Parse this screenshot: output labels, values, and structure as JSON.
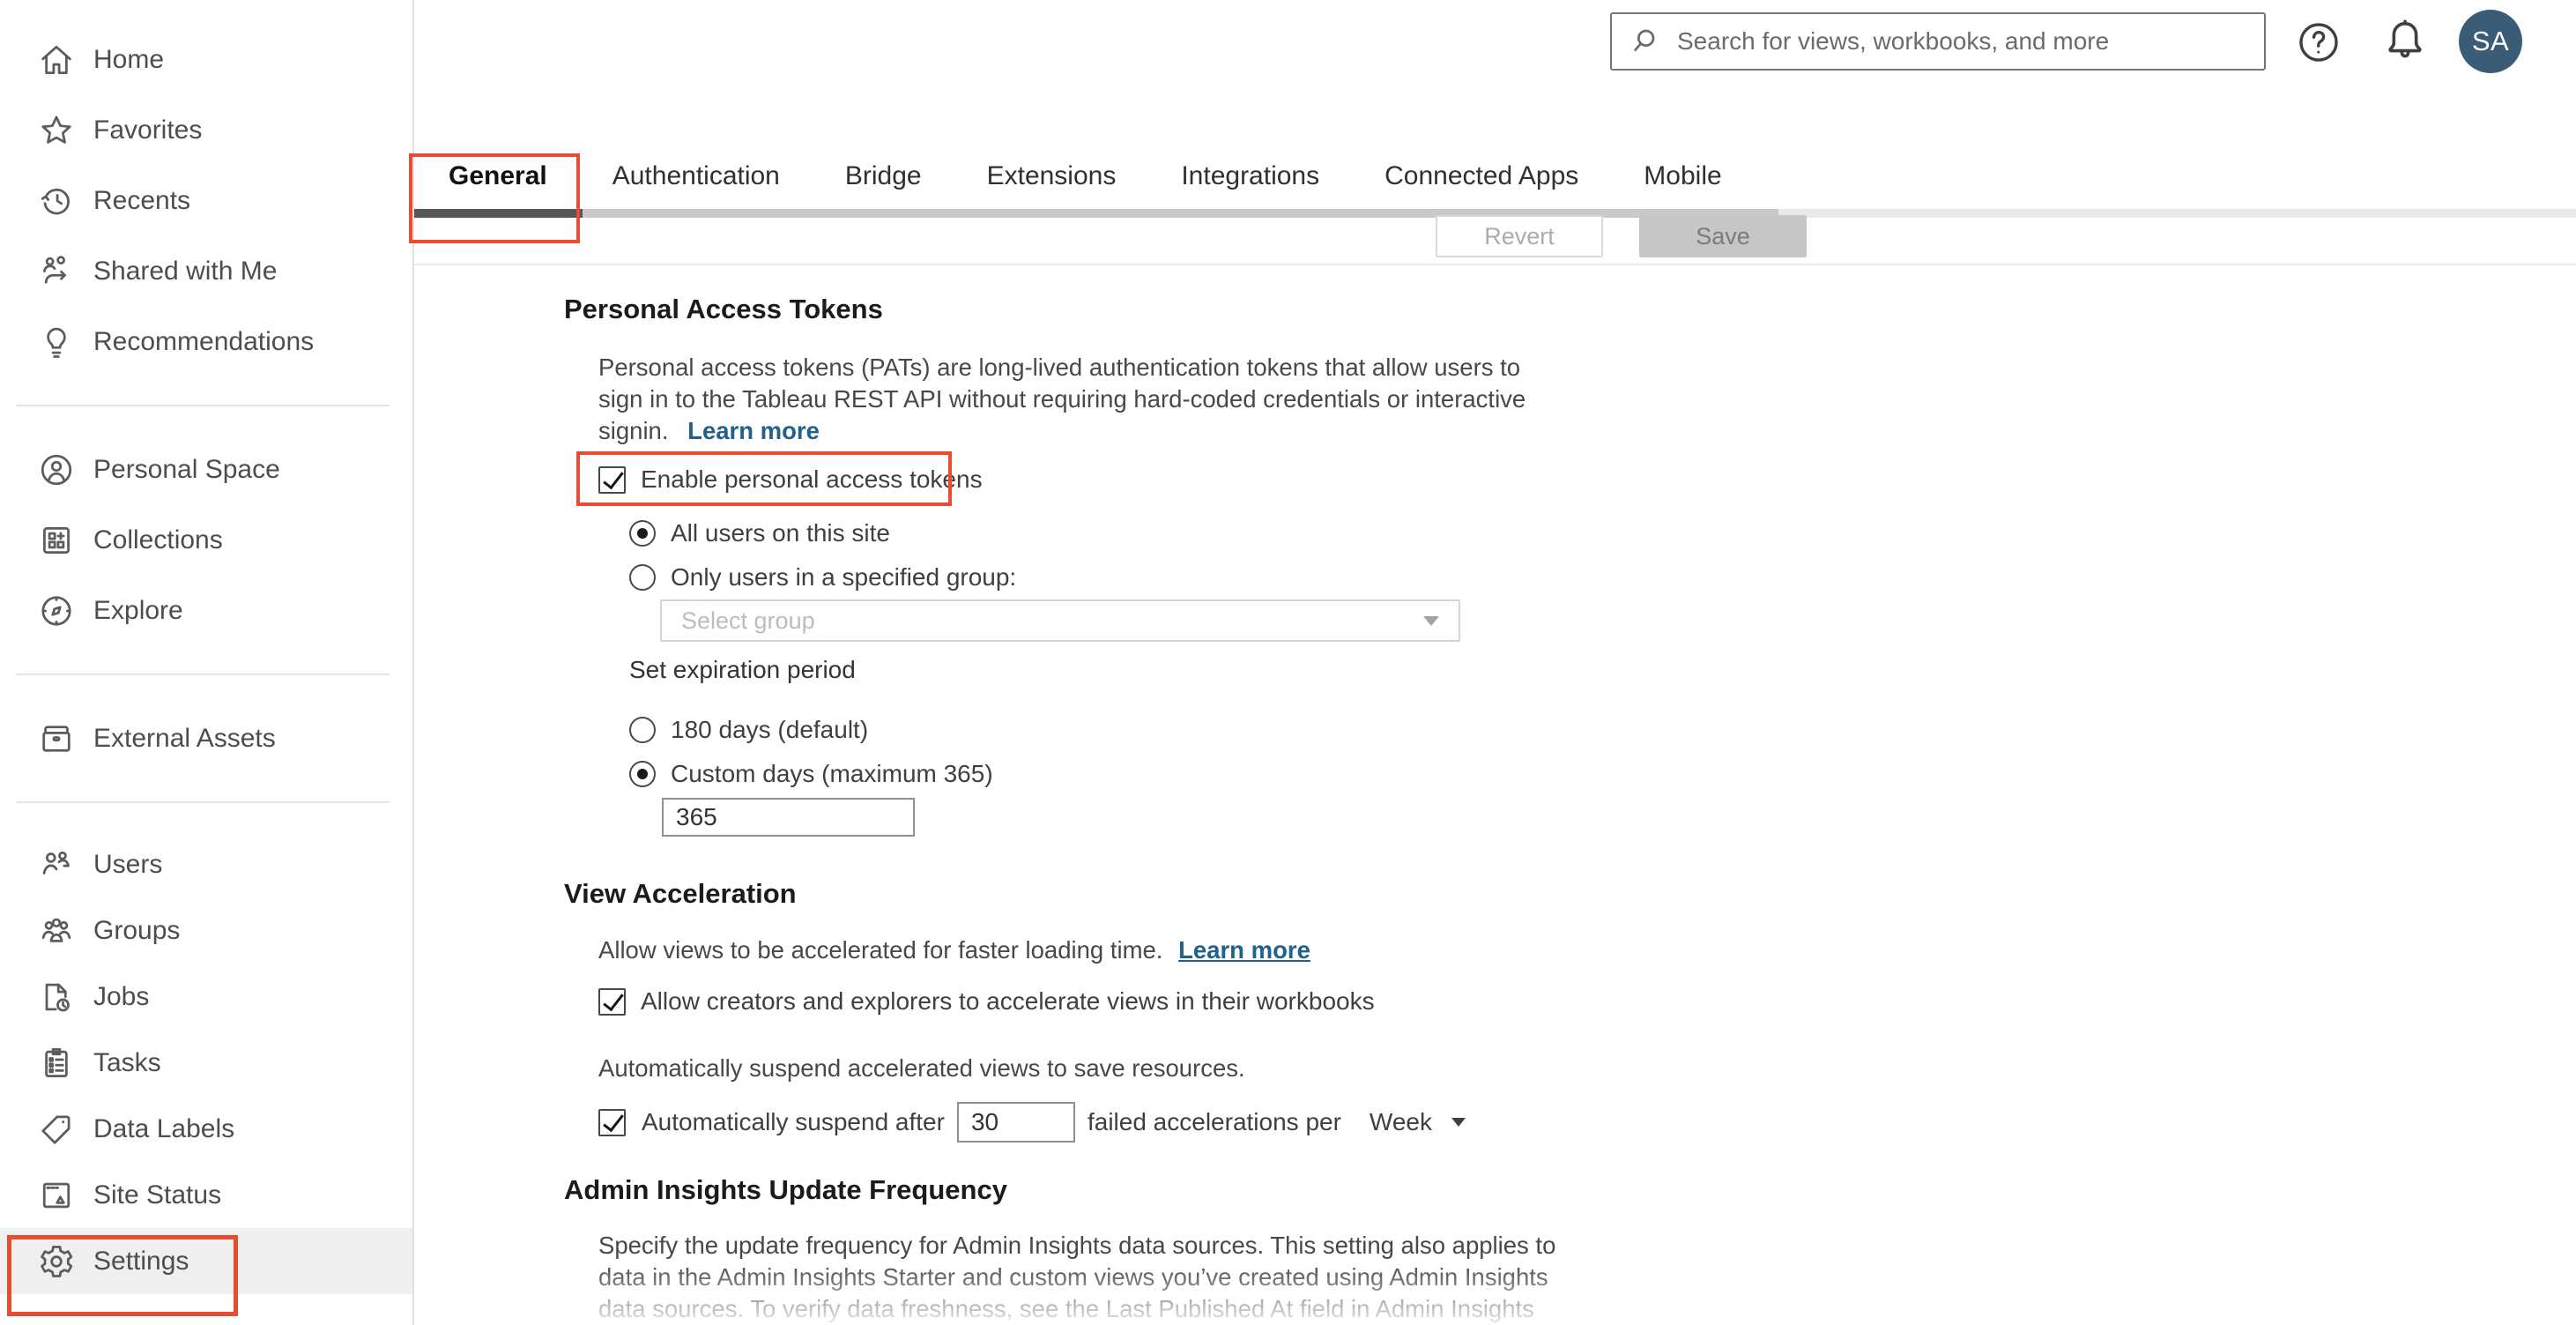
{
  "header": {
    "search_placeholder": "Search for views, workbooks, and more",
    "help_icon": "help-circle-icon",
    "notifications_icon": "bell-icon",
    "avatar_initials": "SA"
  },
  "sidebar": {
    "items": [
      {
        "icon": "home-icon",
        "label": "Home"
      },
      {
        "icon": "star-icon",
        "label": "Favorites"
      },
      {
        "icon": "history-icon",
        "label": "Recents"
      },
      {
        "icon": "shared-icon",
        "label": "Shared with Me"
      },
      {
        "icon": "lightbulb-icon",
        "label": "Recommendations"
      },
      {
        "icon": "person-circle-icon",
        "label": "Personal Space"
      },
      {
        "icon": "collections-icon",
        "label": "Collections"
      },
      {
        "icon": "compass-icon",
        "label": "Explore"
      },
      {
        "icon": "drawer-icon",
        "label": "External Assets"
      },
      {
        "icon": "users-icon",
        "label": "Users"
      },
      {
        "icon": "groups-icon",
        "label": "Groups"
      },
      {
        "icon": "jobs-icon",
        "label": "Jobs"
      },
      {
        "icon": "tasks-icon",
        "label": "Tasks"
      },
      {
        "icon": "tag-icon",
        "label": "Data Labels"
      },
      {
        "icon": "site-status-icon",
        "label": "Site Status"
      },
      {
        "icon": "gear-icon",
        "label": "Settings"
      }
    ],
    "active_item": "Settings"
  },
  "tabs": {
    "items": [
      "General",
      "Authentication",
      "Bridge",
      "Extensions",
      "Integrations",
      "Connected Apps",
      "Mobile"
    ],
    "active": "General"
  },
  "toolbar": {
    "revert_label": "Revert",
    "save_label": "Save"
  },
  "sections": {
    "pat": {
      "title": "Personal Access Tokens",
      "lines": [
        "Personal access tokens (PATs) are long-lived authentication tokens that allow users to",
        "sign in to the Tableau REST API without requiring hard-coded credentials or interactive",
        "signin."
      ],
      "learn_more": "Learn more",
      "enable_label": "Enable personal access tokens",
      "enable_checked": true,
      "radio_all_users": "All users on this site",
      "radio_all_users_selected": true,
      "radio_specified_group": "Only users in a specified group:",
      "group_select_placeholder": "Select group",
      "expiration_label": "Set expiration period",
      "radio_default_days": "180 days (default)",
      "radio_custom_days": "Custom days (maximum 365)",
      "radio_custom_days_selected": true,
      "custom_days_value": "365"
    },
    "view_acceleration": {
      "title": "View Acceleration",
      "description": "Allow views to be accelerated for faster loading time.",
      "learn_more": "Learn more",
      "allow_label": "Allow creators and explorers to accelerate views in their workbooks",
      "allow_checked": true,
      "suspend_intro": "Automatically suspend accelerated views to save resources.",
      "suspend_label": "Automatically suspend after",
      "suspend_checked": true,
      "suspend_value": "30",
      "suspend_suffix": "failed accelerations per",
      "suspend_period": "Week"
    },
    "admin_insights": {
      "title": "Admin Insights Update Frequency",
      "lines": [
        "Specify the update frequency for Admin Insights data sources. This setting also applies to",
        "data in the Admin Insights Starter and custom views you’ve created using Admin Insights",
        "data sources. To verify data freshness, see the Last Published At field in Admin Insights"
      ]
    }
  },
  "colors": {
    "annotation_red": "#ea4b33",
    "link_blue": "#21618b",
    "avatar_bg": "#3a5c77",
    "active_tab_underline": "#575757",
    "tab_track_gray": "#c9c9c9",
    "save_button_bg": "#c6c6c6"
  }
}
